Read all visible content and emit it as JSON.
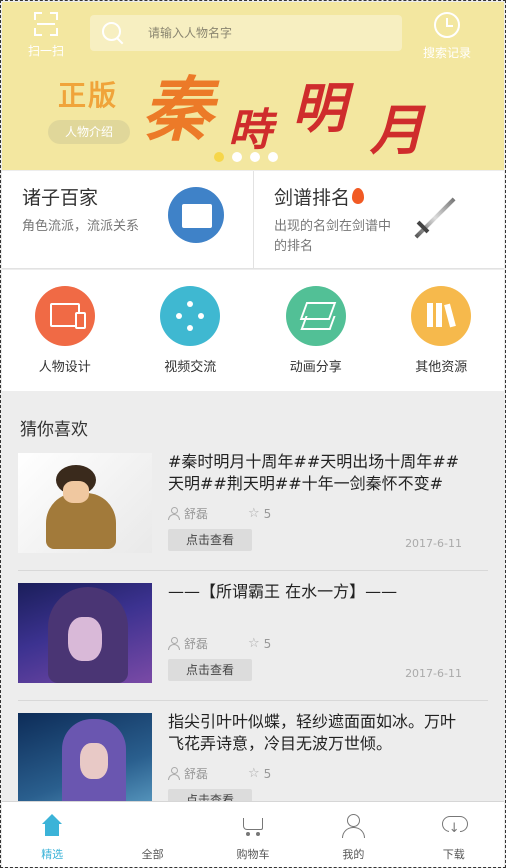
{
  "header": {
    "scan_label": "扫一扫",
    "search_placeholder": "请输入人物名字",
    "history_label": "搜索记录"
  },
  "banner": {
    "badge": "正版",
    "intro_button": "人物介绍",
    "title_art_text": "秦時明月",
    "dots": 4,
    "active_dot": 0
  },
  "features": [
    {
      "title": "诸子百家",
      "desc": "角色流派，流派关系"
    },
    {
      "title": "剑谱排名",
      "desc_line1": "出现的名剑在剑谱中",
      "desc_line2": "的排名"
    }
  ],
  "categories": [
    {
      "label": "人物设计",
      "icon": "ui-icon",
      "color": "#f06a45"
    },
    {
      "label": "视频交流",
      "icon": "video-icon",
      "color": "#3fb8d1"
    },
    {
      "label": "动画分享",
      "icon": "layers-icon",
      "color": "#52c096"
    },
    {
      "label": "其他资源",
      "icon": "books-icon",
      "color": "#f6b94c"
    }
  ],
  "recommend": {
    "title": "猜你喜欢",
    "items": [
      {
        "title": "#秦时明月十周年##天明出场十周年##天明##荆天明##十年一剑秦怀不变#",
        "author": "舒磊",
        "stars": "5",
        "button": "点击查看",
        "date": "2017-6-11"
      },
      {
        "title": "——【所谓霸王 在水一方】——",
        "author": "舒磊",
        "stars": "5",
        "button": "点击查看",
        "date": "2017-6-11"
      },
      {
        "title": "指尖引叶叶似蝶，轻纱遮面面如冰。万叶飞花弄诗意，冷目无波万世倾。",
        "author": "舒磊",
        "stars": "5",
        "button": "点击查看",
        "date": ""
      }
    ]
  },
  "tabbar": [
    {
      "label": "精选",
      "icon": "home-icon",
      "active": true
    },
    {
      "label": "全部",
      "icon": "grid-icon"
    },
    {
      "label": "购物车",
      "icon": "cart-icon"
    },
    {
      "label": "我的",
      "icon": "user-icon"
    },
    {
      "label": "下载",
      "icon": "cloud-download-icon"
    }
  ],
  "colors": {
    "accent": "#3bb3d8",
    "banner_bg": "#f3e7a0"
  }
}
